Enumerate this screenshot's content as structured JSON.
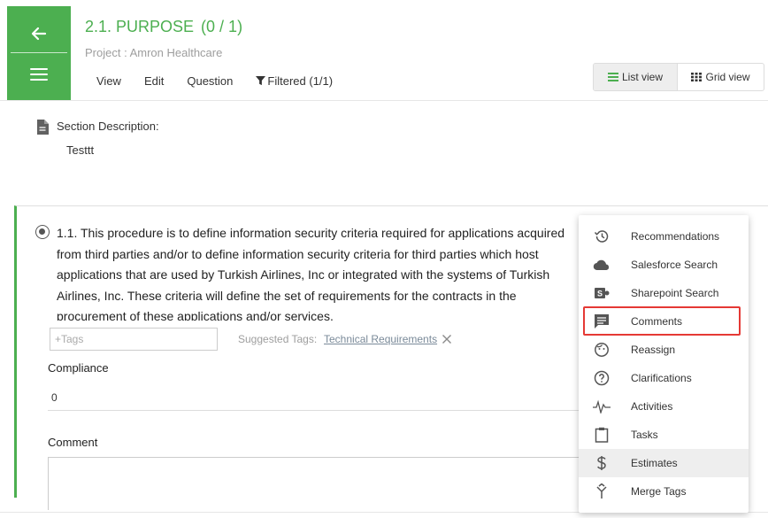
{
  "header": {
    "title": "2.1. PURPOSE",
    "count": "(0 / 1)",
    "subtitle": "Project : Amron Healthcare",
    "nav": [
      "View",
      "Edit",
      "Question",
      "Filtered (1/1)"
    ],
    "list_view_label": "List view",
    "grid_view_label": "Grid view",
    "accent_color": "#4caf50"
  },
  "section": {
    "label": "Section Description:",
    "value": "Testtt"
  },
  "question": {
    "text": "1.1. This procedure is to define information security criteria required for applications acquired from third parties and/or to define information security criteria for third parties which host applications that are used by Turkish Airlines, Inc or integrated with the systems of Turkish Airlines, Inc. These criteria will define the set of requirements for the contracts in the procurement of these applications and/or services.",
    "tags_placeholder": "+Tags",
    "suggested_label": "Suggested Tags:",
    "suggested_tag": "Technical Requirements",
    "compliance_label": "Compliance",
    "compliance_value": "0",
    "comment_label": "Comment"
  },
  "dropdown": {
    "items": [
      {
        "label": "Recommendations",
        "icon": "history-icon"
      },
      {
        "label": "Salesforce Search",
        "icon": "cloud-icon"
      },
      {
        "label": "Sharepoint Search",
        "icon": "sharepoint-icon"
      },
      {
        "label": "Comments",
        "icon": "comment-icon"
      },
      {
        "label": "Reassign",
        "icon": "face-icon"
      },
      {
        "label": "Clarifications",
        "icon": "help-circle-icon"
      },
      {
        "label": "Activities",
        "icon": "pulse-icon"
      },
      {
        "label": "Tasks",
        "icon": "clipboard-icon"
      },
      {
        "label": "Estimates",
        "icon": "dollar-icon"
      },
      {
        "label": "Merge Tags",
        "icon": "merge-icon"
      }
    ],
    "highlighted": "Comments",
    "hovered": "Estimates",
    "highlight_color": "#e53935"
  }
}
